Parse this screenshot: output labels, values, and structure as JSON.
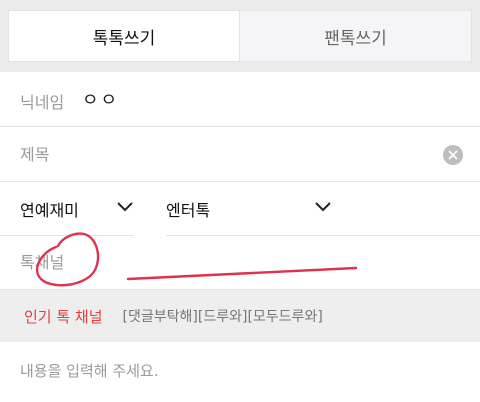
{
  "tabs": [
    {
      "label": "톡톡쓰기",
      "active": true
    },
    {
      "label": "팬톡쓰기",
      "active": false
    }
  ],
  "nickname": {
    "label": "닉네임",
    "value": "ㅇㅇ"
  },
  "title": {
    "placeholder": "제목",
    "value": ""
  },
  "category": {
    "primary": "연예재미",
    "secondary": "엔터톡"
  },
  "channel": {
    "placeholder": "톡채널",
    "value": ""
  },
  "popular_channels": {
    "label": "인기 톡 채널",
    "tags": [
      "[댓글부탁해]",
      "[드루와]",
      "[모두드루와]"
    ]
  },
  "content": {
    "placeholder": "내용을 입력해 주세요."
  },
  "colors": {
    "accent_red": "#e04040",
    "annotation": "#e0324e"
  },
  "icons": {
    "clear": "clear-icon",
    "dropdown": "chevron-down-icon"
  }
}
